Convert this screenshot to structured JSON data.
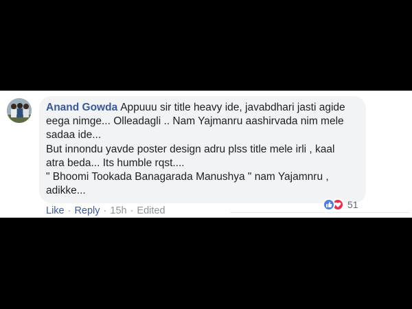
{
  "comment": {
    "author": "Anand Gowda",
    "text_first": "Appuuu sir title heavy ide, javabdhari jasti agide eega nimge... Olleadagli .. Nam Yajmanru aashirvada nim mele sadaa ide...",
    "text_second": "But innondu yavde poster design adru plss title mele irli , kaal atra beda... Its humble rqst....",
    "text_third": "\" Bhoomi Tookada Banagarada Manushya \" nam Yajamnru , adikke..."
  },
  "reactions": {
    "count": "51",
    "icons": [
      "like-reaction-icon",
      "love-reaction-icon"
    ],
    "like_color": "#4a7ee8",
    "love_color": "#f0284a"
  },
  "actions": {
    "like_label": "Like",
    "reply_label": "Reply",
    "time": "15h",
    "edited": "Edited",
    "separator": "·"
  },
  "colors": {
    "author": "#385898",
    "bubble": "#f2f3f5",
    "meta": "#90949c"
  }
}
